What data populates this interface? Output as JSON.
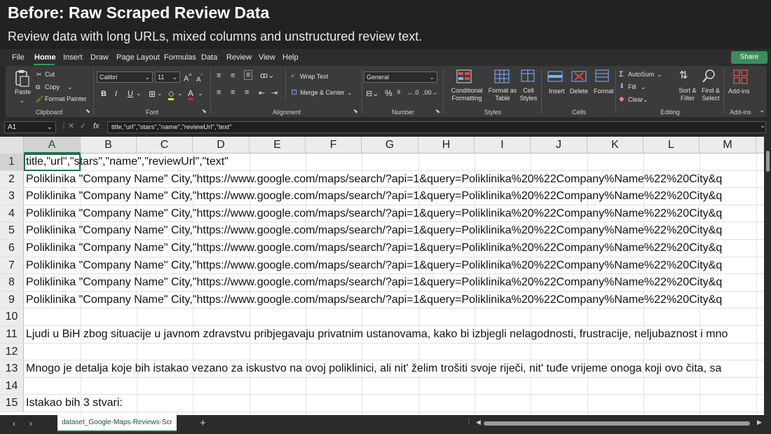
{
  "caption": {
    "title": "Before: Raw Scraped Review Data",
    "subtitle": "Review data with long URLs, mixed columns and unstructured review text."
  },
  "menu": {
    "tabs": [
      "File",
      "Home",
      "Insert",
      "Draw",
      "Page Layout",
      "Formulas",
      "Data",
      "Review",
      "View",
      "Help"
    ],
    "active": "Home",
    "share_label": "Share"
  },
  "ribbon": {
    "clipboard": {
      "paste": "Paste",
      "cut": "Cut",
      "copy": "Copy",
      "format_painter": "Format Painter",
      "label": "Clipboard"
    },
    "font": {
      "name": "Calibri",
      "size": "11",
      "label": "Font"
    },
    "alignment": {
      "wrap": "Wrap Text",
      "merge": "Merge & Center",
      "label": "Alignment"
    },
    "number": {
      "format": "General",
      "label": "Number"
    },
    "styles": {
      "cond": "Conditional Formatting",
      "table": "Format as Table",
      "cell": "Cell Styles",
      "label": "Styles"
    },
    "cells": {
      "insert": "Insert",
      "delete": "Delete",
      "format": "Format",
      "label": "Cells"
    },
    "editing": {
      "autosum": "AutoSum",
      "fill": "Fill",
      "clear": "Clear",
      "sort": "Sort & Filter",
      "find": "Find & Select",
      "label": "Editing"
    },
    "addins": {
      "label": "Add-ins",
      "button": "Add-ins"
    }
  },
  "formula_bar": {
    "name_box": "A1",
    "fx": "fx",
    "value": "title,\"url\",\"stars\",\"name\",\"reviewUrl\",\"text\""
  },
  "sheet": {
    "columns": [
      "A",
      "B",
      "C",
      "D",
      "E",
      "F",
      "G",
      "H",
      "I",
      "J",
      "K",
      "L",
      "M"
    ],
    "selected_cell": "A1",
    "rows": [
      {
        "n": "1",
        "text": "title,\"url\",\"stars\",\"name\",\"reviewUrl\",\"text\""
      },
      {
        "n": "2",
        "text": "Poliklinika \"Company Name\" City,\"https://www.google.com/maps/search/?api=1&query=Poliklinika%20%22Company%Name%22%20City&q"
      },
      {
        "n": "3",
        "text": "Poliklinika \"Company Name\" City,\"https://www.google.com/maps/search/?api=1&query=Poliklinika%20%22Company%Name%22%20City&q"
      },
      {
        "n": "4",
        "text": "Poliklinika \"Company Name\" City,\"https://www.google.com/maps/search/?api=1&query=Poliklinika%20%22Company%Name%22%20City&q"
      },
      {
        "n": "5",
        "text": "Poliklinika \"Company Name\" City,\"https://www.google.com/maps/search/?api=1&query=Poliklinika%20%22Company%Name%22%20City&q"
      },
      {
        "n": "6",
        "text": "Poliklinika \"Company Name\" City,\"https://www.google.com/maps/search/?api=1&query=Poliklinika%20%22Company%Name%22%20City&q"
      },
      {
        "n": "7",
        "text": "Poliklinika \"Company Name\" City,\"https://www.google.com/maps/search/?api=1&query=Poliklinika%20%22Company%Name%22%20City&q"
      },
      {
        "n": "8",
        "text": "Poliklinika \"Company Name\" City,\"https://www.google.com/maps/search/?api=1&query=Poliklinika%20%22Company%Name%22%20City&q"
      },
      {
        "n": "9",
        "text": "Poliklinika \"Company Name\" City,\"https://www.google.com/maps/search/?api=1&query=Poliklinika%20%22Company%Name%22%20City&q"
      },
      {
        "n": "10",
        "text": ""
      },
      {
        "n": "11",
        "text": "Ljudi u BiH zbog situacije u javnom zdravstvu pribjegavaju privatnim ustanovama, kako bi izbjegli nelagodnosti, frustracije, neljubaznost i mno"
      },
      {
        "n": "12",
        "text": ""
      },
      {
        "n": "13",
        "text": "Mnogo je detalja koje bih istakao vezano za iskustvo na ovoj poliklinici, ali nit' želim trošiti svoje riječi, nit' tuđe vrijeme onoga koji ovo čita, sa"
      },
      {
        "n": "14",
        "text": ""
      },
      {
        "n": "15",
        "text": "Istakao bih 3 stvari:"
      }
    ]
  },
  "sheet_tab": {
    "name": "dataset_Google-Maps-Reviews-Scr",
    "add": "+"
  }
}
